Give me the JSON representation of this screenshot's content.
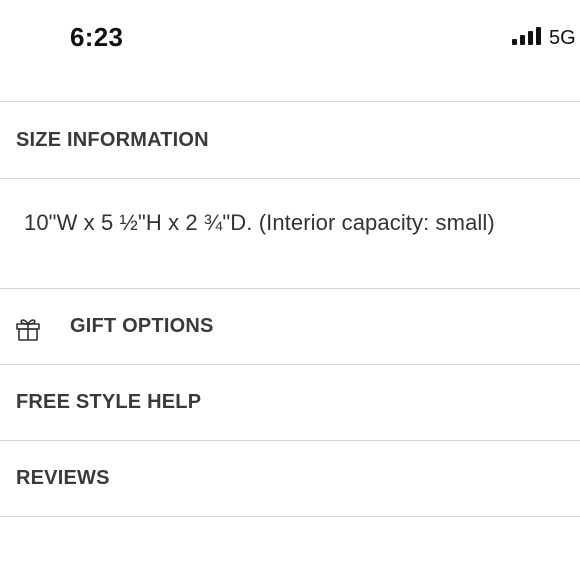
{
  "status_bar": {
    "time": "6:23",
    "network": "5G",
    "signal_icon": "cellular-signal-icon"
  },
  "sections": {
    "size_information": {
      "title": "SIZE INFORMATION",
      "detail": "10\"W x 5 ½\"H x 2 ¾\"D. (Interior capacity: small)"
    },
    "gift_options": {
      "title": "GIFT OPTIONS",
      "icon": "gift-icon"
    },
    "free_style_help": {
      "title": "FREE STYLE HELP"
    },
    "reviews": {
      "title": "REVIEWS"
    }
  },
  "colors": {
    "text": "#333333",
    "divider": "#d9d9d9",
    "background": "#ffffff"
  }
}
